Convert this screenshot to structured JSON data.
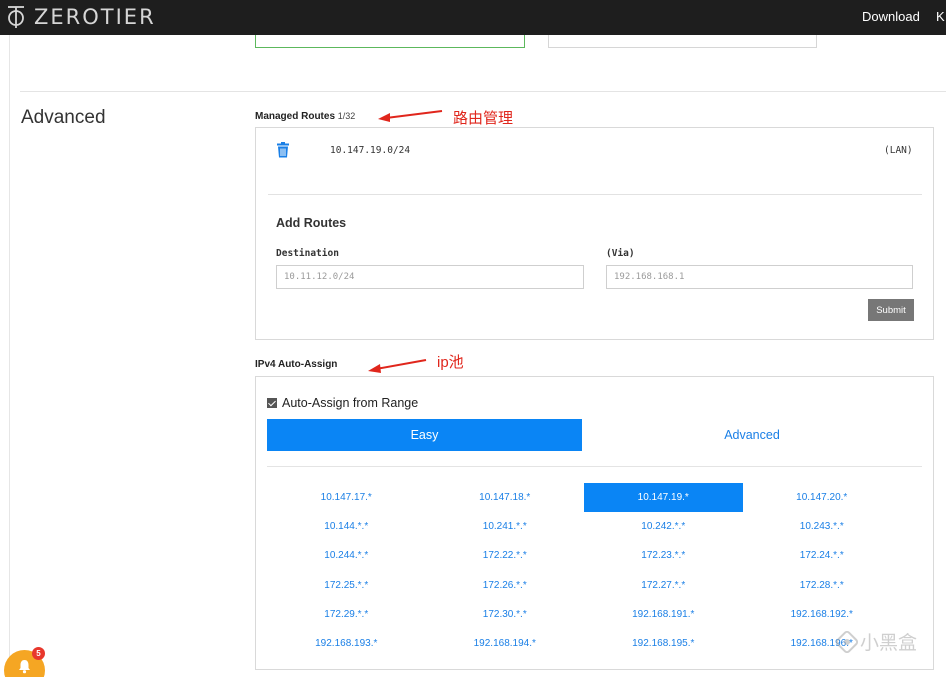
{
  "nav": {
    "brand": "ZEROTIER",
    "download": "Download",
    "k": "K"
  },
  "section": {
    "title": "Advanced"
  },
  "routes": {
    "heading": "Managed Routes",
    "count": "1/32",
    "annotation": "路由管理",
    "items": [
      {
        "target": "10.147.19.0/24",
        "via": "(LAN)"
      }
    ],
    "add": {
      "title": "Add Routes",
      "destination_label": "Destination",
      "via_label": "(Via)",
      "destination_placeholder": "10.11.12.0/24",
      "via_placeholder": "192.168.168.1",
      "submit": "Submit"
    }
  },
  "ipv4": {
    "heading": "IPv4 Auto-Assign",
    "annotation": "ip池",
    "auto_assign_label": "Auto-Assign from Range",
    "auto_assign_checked": true,
    "tabs": {
      "easy": "Easy",
      "advanced": "Advanced"
    },
    "selected": "10.147.19.*",
    "ranges": [
      "10.147.17.*",
      "10.147.18.*",
      "10.147.19.*",
      "10.147.20.*",
      "10.144.*.*",
      "10.241.*.*",
      "10.242.*.*",
      "10.243.*.*",
      "10.244.*.*",
      "172.22.*.*",
      "172.23.*.*",
      "172.24.*.*",
      "172.25.*.*",
      "172.26.*.*",
      "172.27.*.*",
      "172.28.*.*",
      "172.29.*.*",
      "172.30.*.*",
      "192.168.191.*",
      "192.168.192.*",
      "192.168.193.*",
      "192.168.194.*",
      "192.168.195.*",
      "192.168.196.*"
    ]
  },
  "notification": {
    "count": "5"
  },
  "watermark": {
    "text": "小黑盒"
  },
  "colors": {
    "accent": "#0a85f5",
    "link": "#1a7fe6",
    "annotation": "#e0261c",
    "badge": "#e8372c",
    "bell": "#f5a623"
  }
}
